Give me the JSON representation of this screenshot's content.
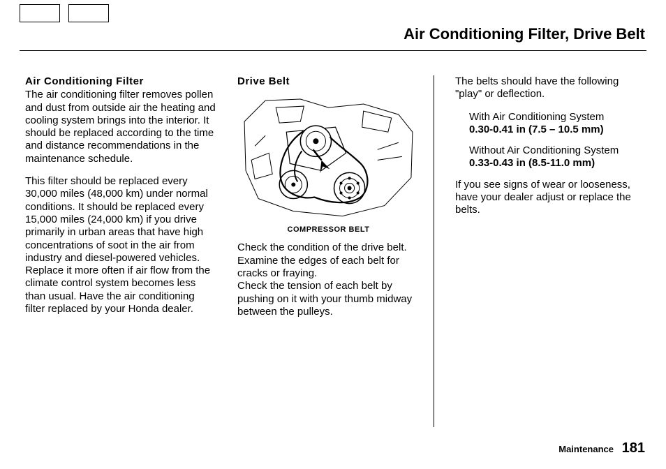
{
  "page_title": "Air Conditioning Filter, Drive Belt",
  "col1": {
    "head": "Air Conditioning Filter",
    "p1": "The air conditioning filter removes pollen and dust from outside air the heating and cooling system brings into the interior. It should be replaced according to the time and distance recommendations in the maintenance schedule.",
    "p2": "This filter should be replaced every 30,000 miles (48,000 km) under normal conditions. It should be replaced every 15,000 miles (24,000 km) if you drive primarily in urban areas that have high concentrations of soot in the air from industry and diesel-powered vehicles. Replace it more often if air flow from the climate control system becomes less than usual. Have the air conditioning filter replaced by your Honda dealer."
  },
  "col2": {
    "head": "Drive Belt",
    "caption": "COMPRESSOR BELT",
    "p1": "Check the condition of the drive belt. Examine the edges of each belt for cracks or fraying.",
    "p2": "Check the tension of each belt by pushing on it with your thumb midway between the pulleys."
  },
  "col3": {
    "p1": "The belts should have the following \"play\" or deflection.",
    "with_label": "With Air Conditioning System",
    "with_value": "0.30-0.41 in (7.5 – 10.5 mm)",
    "without_label": "Without Air Conditioning System",
    "without_value": "0.33-0.43 in (8.5-11.0 mm)",
    "p2": "If you see signs of wear or looseness, have your dealer adjust or replace the belts."
  },
  "footer": {
    "label": "Maintenance",
    "page": "181"
  }
}
